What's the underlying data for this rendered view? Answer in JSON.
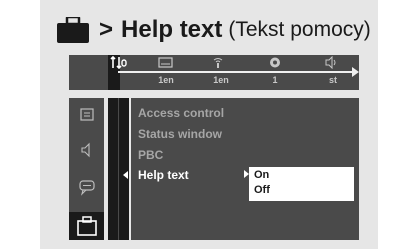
{
  "heading": {
    "arrow": ">",
    "title": "Help text",
    "subtitle": "(Tekst pomocy)",
    "icon": "briefcase-icon"
  },
  "top_bar": {
    "items": [
      {
        "icon": "settings-icon",
        "value": ""
      },
      {
        "icon": "subtitle-icon",
        "value": "1en"
      },
      {
        "icon": "audio-icon",
        "value": "1en"
      },
      {
        "icon": "angle-icon",
        "value": "1"
      },
      {
        "icon": "sound-icon",
        "value": "st"
      }
    ]
  },
  "sidebar": {
    "items": [
      {
        "icon": "picture-icon"
      },
      {
        "icon": "speaker-icon"
      },
      {
        "icon": "chat-icon"
      },
      {
        "icon": "briefcase-icon",
        "selected": true
      }
    ]
  },
  "menu": {
    "items": [
      {
        "label": "Access control"
      },
      {
        "label": "Status window"
      },
      {
        "label": "PBC"
      },
      {
        "label": "Help text",
        "active": true
      }
    ]
  },
  "submenu": {
    "options": [
      "On",
      "Off"
    ],
    "selected": "On"
  },
  "colors": {
    "panel": "#4a4a4a",
    "stripe": "#1a1a1a",
    "text_dim": "#a6a6a6",
    "text_active": "#ffffff"
  }
}
